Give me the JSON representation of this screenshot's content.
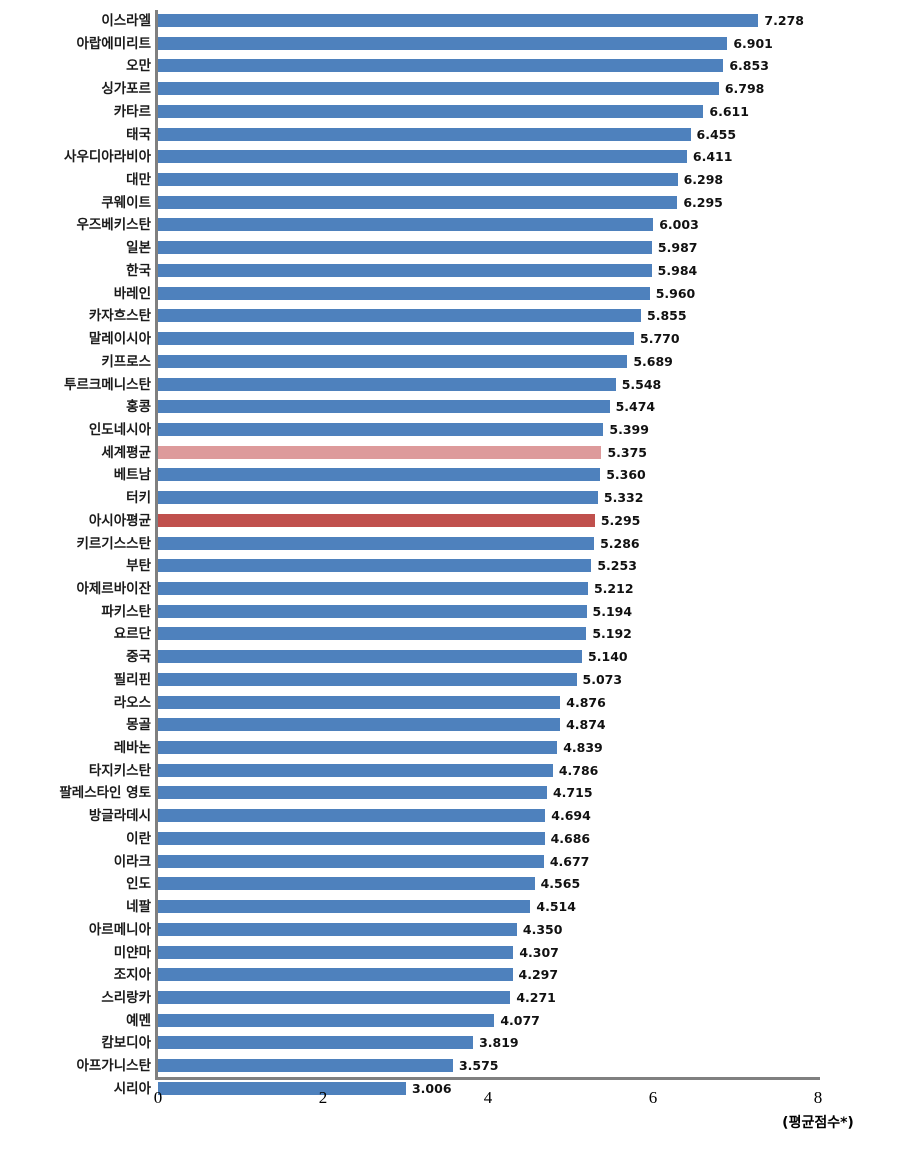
{
  "chart_data": {
    "type": "bar",
    "orientation": "horizontal",
    "title": "",
    "xlabel": "(평균점수*)",
    "ylabel": "",
    "xlim": [
      0,
      8
    ],
    "xticks": [
      0,
      2,
      4,
      6,
      8
    ],
    "grid": false,
    "legend": null,
    "colors": {
      "bar": "#4E81BD",
      "world_average": "#DD9A9B",
      "asia_average": "#C0504D",
      "axis": "#808080"
    },
    "categories": [
      "이스라엘",
      "아랍에미리트",
      "오만",
      "싱가포르",
      "카타르",
      "태국",
      "사우디아라비아",
      "대만",
      "쿠웨이트",
      "우즈베키스탄",
      "일본",
      "한국",
      "바레인",
      "카자흐스탄",
      "말레이시아",
      "키프로스",
      "투르크메니스탄",
      "홍콩",
      "인도네시아",
      "세계평균",
      "베트남",
      "터키",
      "아시아평균",
      "키르기스스탄",
      "부탄",
      "아제르바이잔",
      "파키스탄",
      "요르단",
      "중국",
      "필리핀",
      "라오스",
      "몽골",
      "레바논",
      "타지키스탄",
      "팔레스타인 영토",
      "방글라데시",
      "이란",
      "이라크",
      "인도",
      "네팔",
      "아르메니아",
      "미얀마",
      "조지아",
      "스리랑카",
      "예멘",
      "캄보디아",
      "아프가니스탄",
      "시리아"
    ],
    "values": [
      7.278,
      6.901,
      6.853,
      6.798,
      6.611,
      6.455,
      6.411,
      6.298,
      6.295,
      6.003,
      5.987,
      5.984,
      5.96,
      5.855,
      5.77,
      5.689,
      5.548,
      5.474,
      5.399,
      5.375,
      5.36,
      5.332,
      5.295,
      5.286,
      5.253,
      5.212,
      5.194,
      5.192,
      5.14,
      5.073,
      4.876,
      4.874,
      4.839,
      4.786,
      4.715,
      4.694,
      4.686,
      4.677,
      4.565,
      4.514,
      4.35,
      4.307,
      4.297,
      4.271,
      4.077,
      3.819,
      3.575,
      3.006
    ],
    "value_labels": [
      "7.278",
      "6.901",
      "6.853",
      "6.798",
      "6.611",
      "6.455",
      "6.411",
      "6.298",
      "6.295",
      "6.003",
      "5.987",
      "5.984",
      "5.960",
      "5.855",
      "5.770",
      "5.689",
      "5.548",
      "5.474",
      "5.399",
      "5.375",
      "5.360",
      "5.332",
      "5.295",
      "5.286",
      "5.253",
      "5.212",
      "5.194",
      "5.192",
      "5.140",
      "5.073",
      "4.876",
      "4.874",
      "4.839",
      "4.786",
      "4.715",
      "4.694",
      "4.686",
      "4.677",
      "4.565",
      "4.514",
      "4.350",
      "4.307",
      "4.297",
      "4.271",
      "4.077",
      "3.819",
      "3.575",
      "3.006"
    ],
    "highlight": {
      "세계평균": "world-avg",
      "아시아평균": "asia-avg"
    },
    "xtick_labels": [
      "0",
      "2",
      "4",
      "6",
      "8"
    ]
  }
}
